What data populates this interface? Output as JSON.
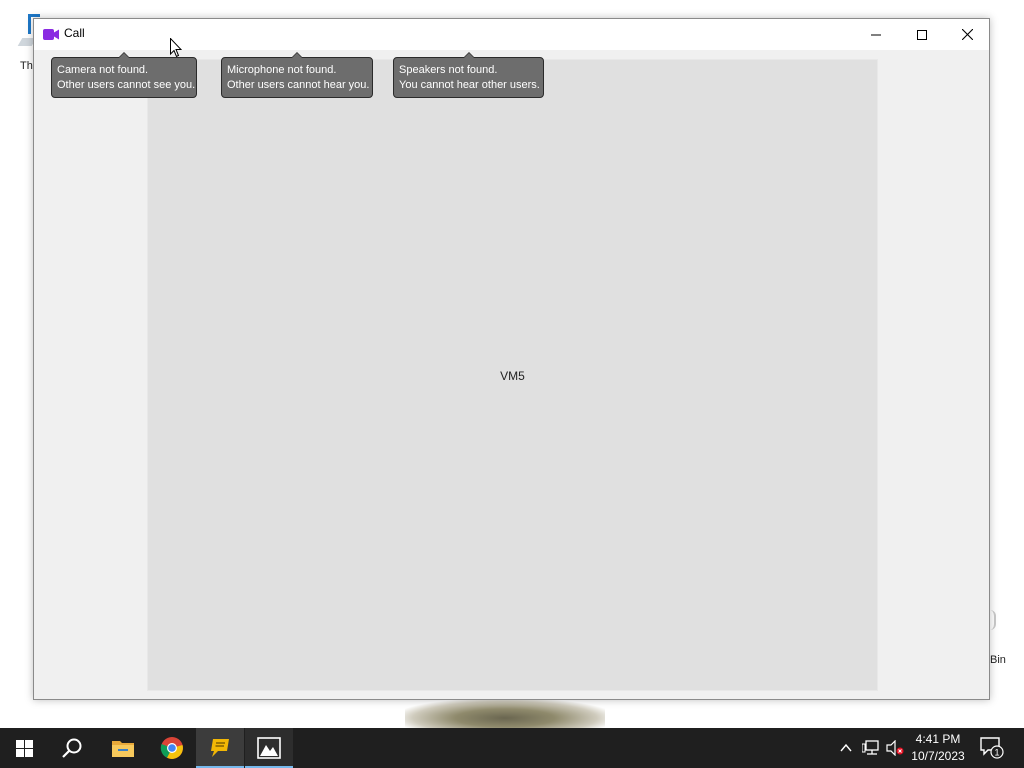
{
  "desktop": {
    "left_icon_label": "Th",
    "right_icon_label": "Bin"
  },
  "window": {
    "title": "Call",
    "app_icon": "video-camera-icon",
    "controls": {
      "minimize": "minimize-icon",
      "maximize": "maximize-icon",
      "close": "close-icon"
    },
    "tooltips": [
      {
        "line1": "Camera not found.",
        "line2": "Other users cannot see you."
      },
      {
        "line1": "Microphone not found.",
        "line2": "Other users cannot hear you."
      },
      {
        "line1": "Speakers not found.",
        "line2": "You cannot hear other users."
      }
    ],
    "video": {
      "participant_label": "VM5"
    }
  },
  "taskbar": {
    "items": [
      {
        "name": "start",
        "icon": "windows-logo-icon"
      },
      {
        "name": "search",
        "icon": "search-icon"
      },
      {
        "name": "file-explorer",
        "icon": "folder-icon"
      },
      {
        "name": "chrome",
        "icon": "chrome-icon"
      },
      {
        "name": "messenger",
        "icon": "chat-bubble-icon",
        "active": true
      },
      {
        "name": "photos",
        "icon": "photos-icon",
        "active": true
      }
    ],
    "tray": {
      "icons": [
        "chevron-up-icon",
        "network-icon",
        "volume-muted-icon"
      ],
      "time": "4:41 PM",
      "date": "10/7/2023",
      "notification_count": "1"
    }
  },
  "colors": {
    "window_bg": "#f0f0f0",
    "video_bg": "#e0e0e0",
    "tooltip_bg": "#6d6d6d",
    "taskbar_bg": "#1f1f1f",
    "app_icon_purple": "#8a2be2"
  }
}
